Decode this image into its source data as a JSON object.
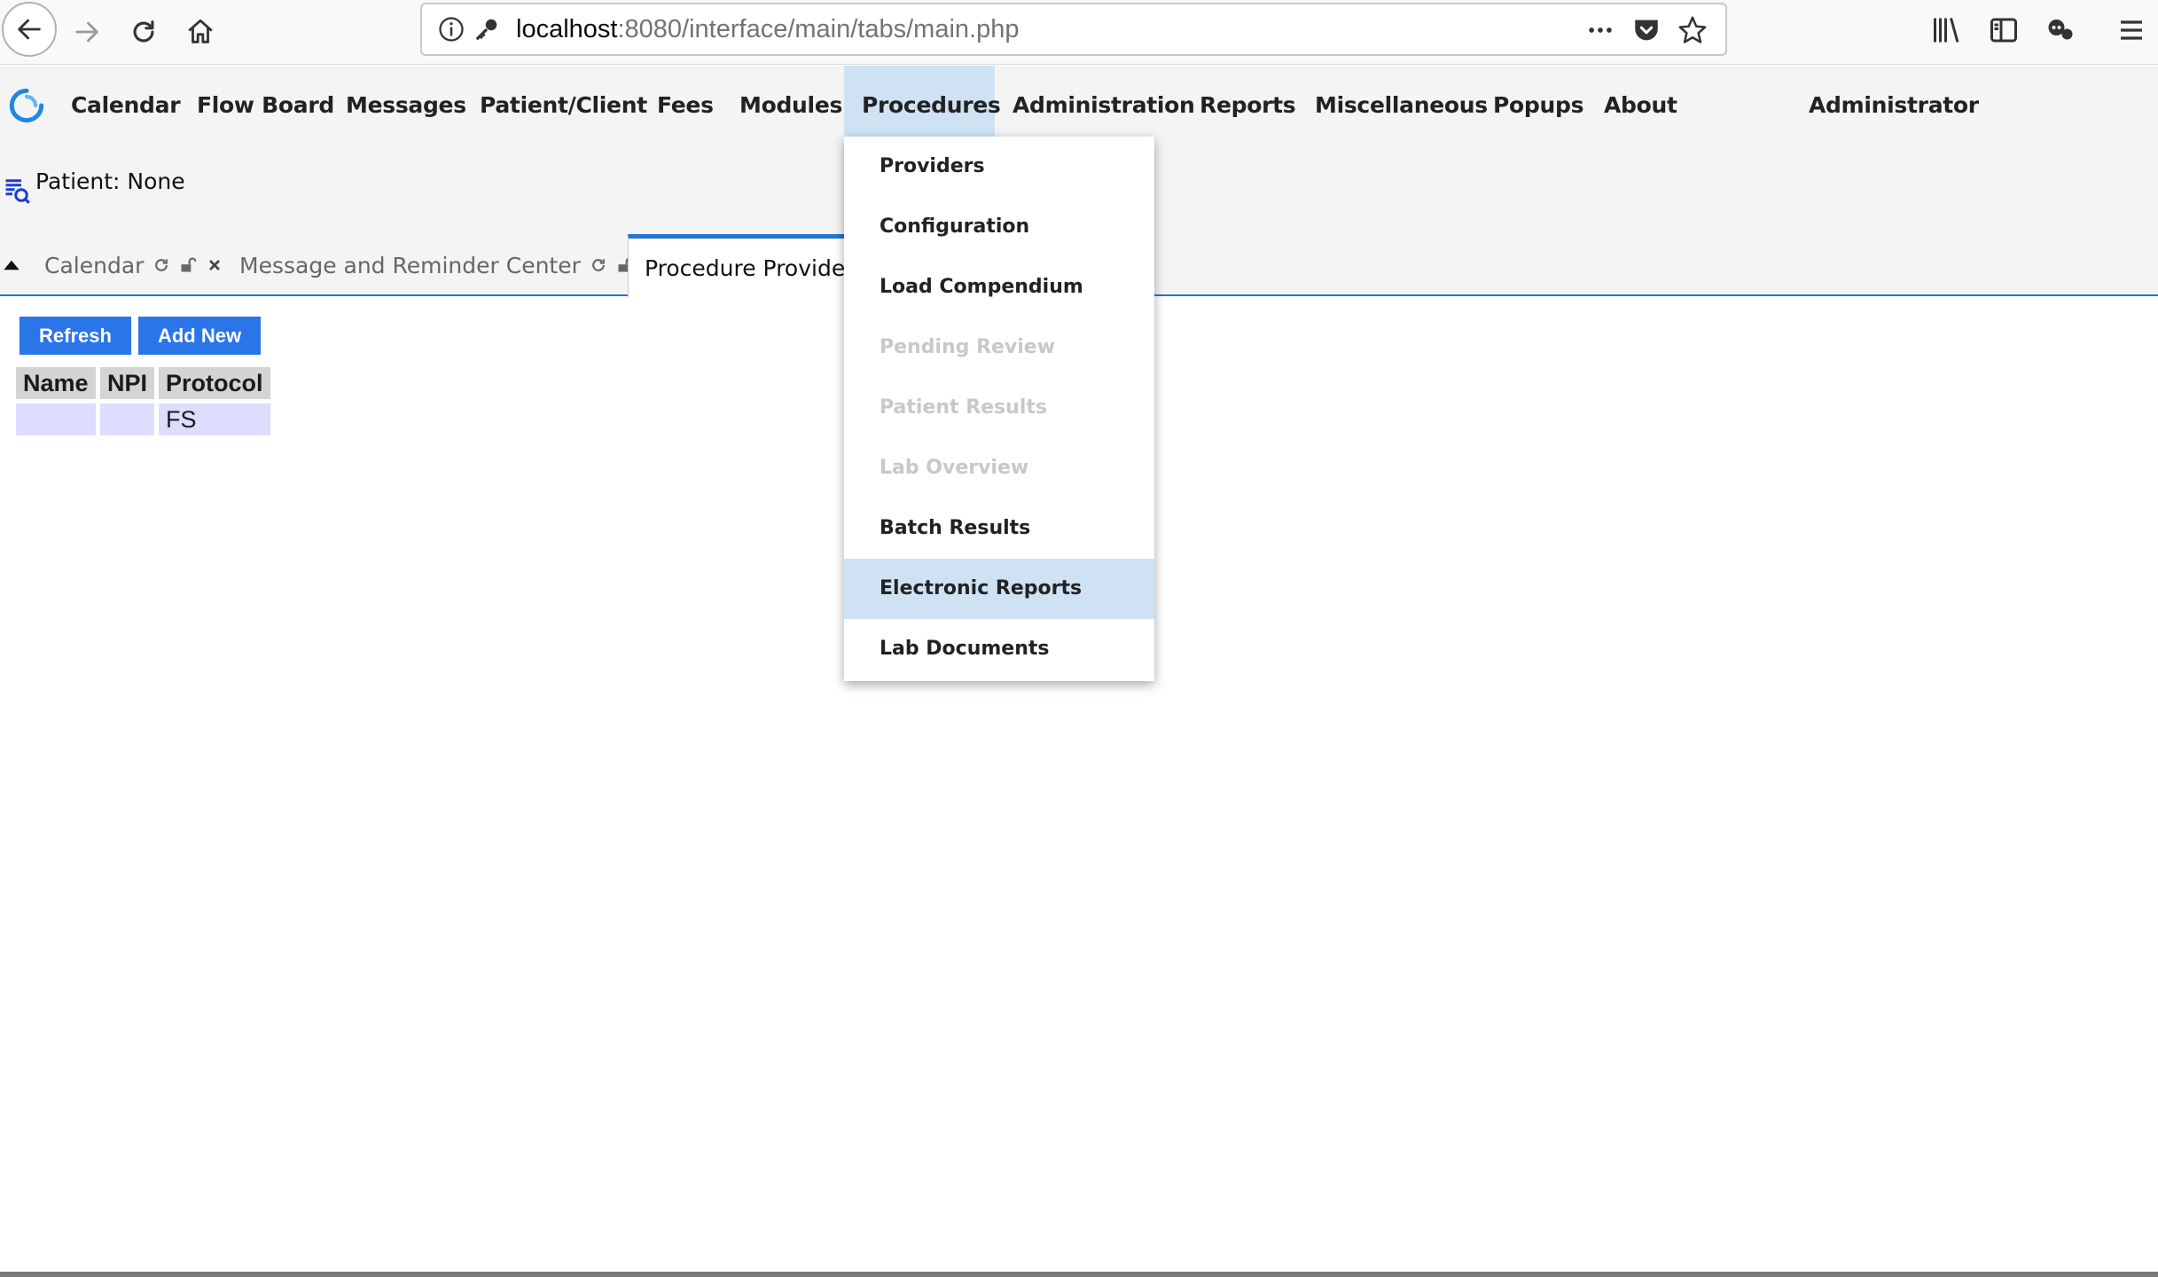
{
  "browser": {
    "url_host": "localhost",
    "url_rest": ":8080/interface/main/tabs/main.php"
  },
  "nav": {
    "items": [
      "Calendar",
      "Flow Board",
      "Messages",
      "Patient/Client",
      "Fees",
      "Modules",
      "Procedures",
      "Administration",
      "Reports",
      "Miscellaneous",
      "Popups",
      "About"
    ],
    "active": "Procedures",
    "user": "Administrator"
  },
  "patient": {
    "label": "Patient: None"
  },
  "tabs": [
    {
      "label": "Calendar"
    },
    {
      "label": "Message and Reminder Center"
    },
    {
      "label": "Procedure Providers"
    }
  ],
  "content": {
    "refresh_label": "Refresh",
    "add_new_label": "Add New",
    "table": {
      "headers": [
        "Name",
        "NPI",
        "Protocol"
      ],
      "rows": [
        [
          "",
          "",
          "FS"
        ]
      ]
    }
  },
  "dropdown": {
    "items": [
      {
        "label": "Providers",
        "state": "enabled"
      },
      {
        "label": "Configuration",
        "state": "enabled"
      },
      {
        "label": "Load Compendium",
        "state": "enabled"
      },
      {
        "label": "Pending Review",
        "state": "disabled"
      },
      {
        "label": "Patient Results",
        "state": "disabled"
      },
      {
        "label": "Lab Overview",
        "state": "disabled"
      },
      {
        "label": "Batch Results",
        "state": "enabled"
      },
      {
        "label": "Electronic Reports",
        "state": "hover"
      },
      {
        "label": "Lab Documents",
        "state": "enabled"
      }
    ]
  },
  "colors": {
    "accent": "#2176d2",
    "button": "#2a75e8",
    "menu_highlight": "#cfe2f3",
    "row_bg": "#ddddff",
    "header_bg": "#d4d4d4"
  },
  "icons": [
    "back-icon",
    "forward-icon",
    "reload-icon",
    "home-icon",
    "info-icon",
    "key-icon",
    "more-icon",
    "pocket-icon",
    "bookmark-star-icon",
    "library-icon",
    "sidebar-icon",
    "extension-icon",
    "hamburger-menu-icon",
    "app-logo",
    "patient-search-icon",
    "refresh-tab-icon",
    "unlock-icon",
    "close-icon",
    "collapse-arrow-icon"
  ]
}
